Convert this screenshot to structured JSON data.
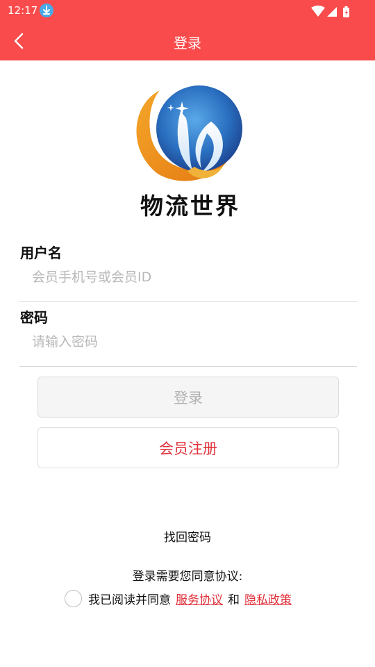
{
  "status_bar": {
    "time": "12:17",
    "download_icon": "download-icon"
  },
  "app_bar": {
    "title": "登录",
    "back_icon": "back-icon"
  },
  "logo": {
    "text": "物流世界"
  },
  "form": {
    "username": {
      "label": "用户名",
      "placeholder": "会员手机号或会员ID",
      "value": ""
    },
    "password": {
      "label": "密码",
      "placeholder": "请输入密码",
      "value": ""
    }
  },
  "buttons": {
    "login": "登录",
    "register": "会员注册"
  },
  "links": {
    "find_password": "找回密码"
  },
  "agreement": {
    "heading": "登录需要您同意协议:",
    "prefix": "我已阅读并同意",
    "service": "服务协议",
    "and": "和",
    "privacy": "隐私政策",
    "checked": false
  },
  "colors": {
    "accent": "#f94b4c",
    "link": "#e0303a",
    "placeholder": "#b8b8b8"
  }
}
